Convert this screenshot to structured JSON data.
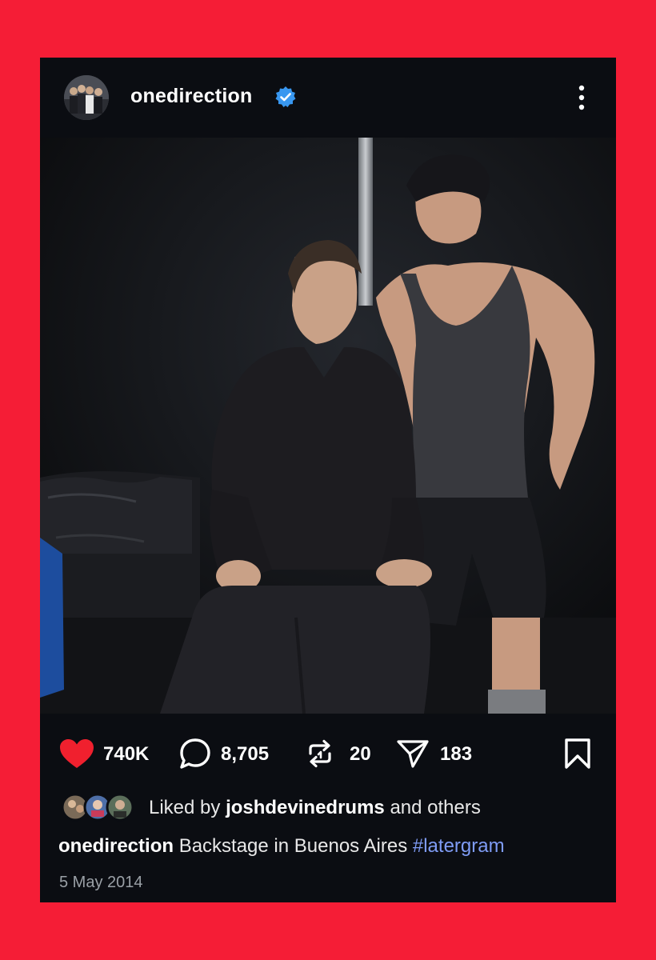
{
  "post": {
    "username": "onedirection",
    "verified": true,
    "stats": {
      "likes": "740K",
      "comments": "8,705",
      "reposts": "20",
      "shares": "183"
    },
    "liked_by": {
      "prefix": "Liked by",
      "user": "joshdevinedrums",
      "suffix": "and others"
    },
    "caption": {
      "user": "onedirection",
      "text": "Backstage in Buenos Aires",
      "hashtag": "#latergram"
    },
    "date": "5 May 2014"
  },
  "colors": {
    "background": "#f51d36",
    "card": "#0b0d12",
    "heart": "#f0202e",
    "verified": "#3897f0",
    "hashtag": "#7f9cf5"
  },
  "icons": {
    "verified": "verified-badge-icon",
    "more": "more-vertical-icon",
    "like": "heart-icon",
    "comment": "comment-icon",
    "repost": "repost-icon",
    "share": "send-icon",
    "save": "bookmark-icon"
  }
}
